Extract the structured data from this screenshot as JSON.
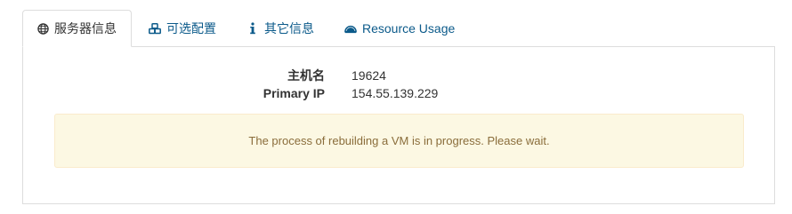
{
  "tabs": [
    {
      "label": "服务器信息",
      "icon": "globe-icon",
      "active": true
    },
    {
      "label": "可选配置",
      "icon": "cubes-icon",
      "active": false
    },
    {
      "label": "其它信息",
      "icon": "info-icon",
      "active": false
    },
    {
      "label": "Resource Usage",
      "icon": "dashboard-icon",
      "active": false
    }
  ],
  "server_info": {
    "hostname_label": "主机名",
    "hostname_value": "19624",
    "primary_ip_label": "Primary IP",
    "primary_ip_value": "154.55.139.229"
  },
  "alert": {
    "message": "The process of rebuilding a VM is in progress. Please wait."
  },
  "colors": {
    "link": "#0b5a8a",
    "alert_bg": "#fcf8e3",
    "alert_border": "#faebcc",
    "alert_text": "#8a6d3b"
  }
}
